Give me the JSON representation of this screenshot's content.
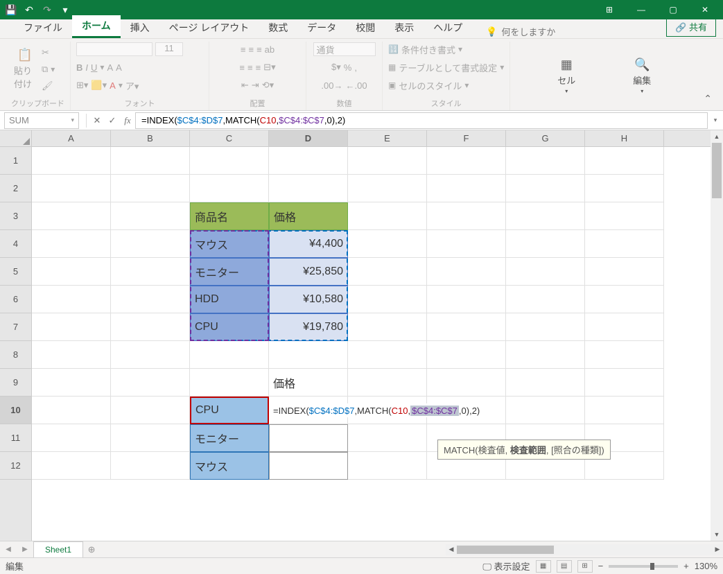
{
  "titlebar": {
    "ribbon_display": "⊞"
  },
  "tabs": {
    "file": "ファイル",
    "home": "ホーム",
    "insert": "挿入",
    "pagelayout": "ページ レイアウト",
    "formulas": "数式",
    "data": "データ",
    "review": "校閲",
    "view": "表示",
    "help": "ヘルプ",
    "tellme": "何をしますか",
    "share": "共有"
  },
  "ribbon": {
    "clipboard": {
      "paste": "貼り付け",
      "title": "クリップボード"
    },
    "font": {
      "size": "11",
      "title": "フォント"
    },
    "align": {
      "title": "配置"
    },
    "number": {
      "format": "通貨",
      "title": "数値"
    },
    "styles": {
      "cond": "条件付き書式",
      "table": "テーブルとして書式設定",
      "cell": "セルのスタイル",
      "title": "スタイル"
    },
    "cells": {
      "label": "セル"
    },
    "editing": {
      "label": "編集"
    }
  },
  "namebox": "SUM",
  "formula": {
    "prefix": "=INDEX(",
    "r1": "$C$4:$D$7",
    "m": ",MATCH(",
    "r2": "C10",
    "c": ",",
    "r3": "$C$4:$C$7",
    "suffix": ",0),2)"
  },
  "cols": [
    "A",
    "B",
    "C",
    "D",
    "E",
    "F",
    "G",
    "H"
  ],
  "rows": [
    "1",
    "2",
    "3",
    "4",
    "5",
    "6",
    "7",
    "8",
    "9",
    "10",
    "11",
    "12"
  ],
  "data": {
    "C3": "商品名",
    "D3": "価格",
    "C4": "マウス",
    "D4": "¥4,400",
    "C5": "モニター",
    "D5": "¥25,850",
    "C6": "HDD",
    "D6": "¥10,580",
    "C7": "CPU",
    "D7": "¥19,780",
    "D9": "価格",
    "C10": "CPU",
    "C11": "モニター",
    "C12": "マウス"
  },
  "cellformula": {
    "prefix": "=INDEX(",
    "r1": "$C$4:$D$7",
    "m": ",MATCH(",
    "r2": "C10",
    "c": ",",
    "r3": "$C$4:$C$7",
    "suffix": ",0),2)"
  },
  "tooltip": {
    "fn": "MATCH(",
    "a1": "検査値",
    "sep": ", ",
    "a2": "検査範囲",
    "a3": "[照合の種類]",
    "end": ")"
  },
  "sheet": "Sheet1",
  "status": {
    "mode": "編集",
    "display": "表示設定",
    "zoom": "130%"
  }
}
